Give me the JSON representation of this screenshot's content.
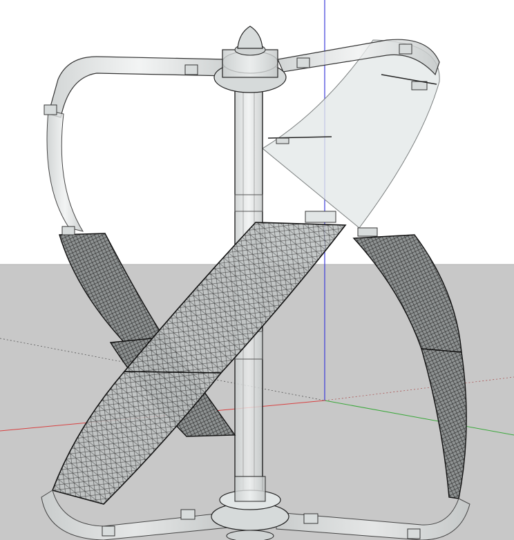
{
  "viewport": {
    "sky_color": "#ffffff",
    "ground_color": "#c8c8c8",
    "axis_colors": {
      "blue": "#3a3ad8",
      "red": "#d84040",
      "green": "#3aa83a"
    }
  },
  "model": {
    "line_color": "#111111",
    "glass_color": "#dfe3e3",
    "mesh_color": "#333333"
  }
}
